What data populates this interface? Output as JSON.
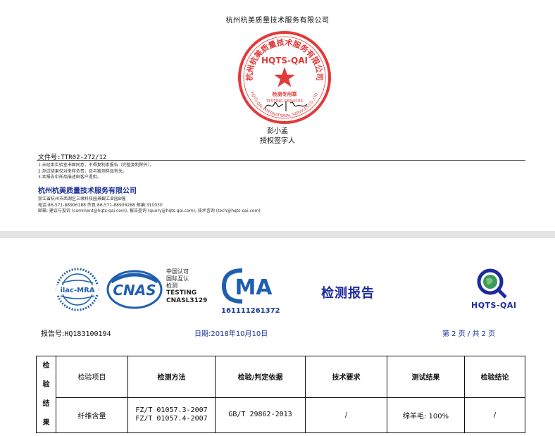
{
  "cert_page": {
    "company_header": "杭州杭美质量技术服务有限公司",
    "seal": {
      "ring_text": "杭州杭美质量技术服务有限公司",
      "center_text": "HQTS-QAI",
      "dept_text": "检测专用章",
      "testing_services": "TESTING SERVICES",
      "bottom_ring": "HQTS-QAI INTERNATIONAL SERVICES CO.,LTD."
    },
    "signer_name": "彭小孟",
    "signer_title": "授权签字人",
    "doc_number": "文件号:TTR02-272/12",
    "notes": [
      "1.未经本实验室书面同意，不得复制本报告（完整复制除外）。",
      "2.测试结果仅对来样负责，且与被测样品有关。",
      "3.本报告中样品描述由客户提供。"
    ],
    "company_name": "杭州杭美质量技术服务有限公司",
    "address_lines": [
      "浙江省杭州市西湖区三墩科技园景観工业园B幢",
      "电话:86-571-88906188   传真:86-571-88906288   邮编:310030",
      "邮箱: 建议与投诉 (comment@hqts-qai.com), 报告查询 (query@hqts-qai.com), 技术咨询 (tech@hqts-qai.com)"
    ]
  },
  "report_page": {
    "logos": {
      "ilac": "ilac-MRA",
      "cnas": "CNAS",
      "cnas_text": [
        "中国认可",
        "国际互认",
        "检测",
        "TESTING",
        "CNASL3129"
      ],
      "ma": "MA",
      "ma_number": "161111261372",
      "hqts": "HQTS-QAI"
    },
    "title": "检测报告",
    "report_no_label": "报告号:",
    "report_no": "HQ183100194",
    "date": "日期:2018年10月10日",
    "page": "第 2 页 / 共 2 页",
    "table": {
      "side_label": [
        "检",
        "验",
        "结",
        "果"
      ],
      "headers": [
        "检验项目",
        "检测方法",
        "检验/判定依据",
        "技术要求",
        "测试结果",
        "检验结论"
      ],
      "row": {
        "item": "纤维含量",
        "method_1": "FZ/T 01057.3-2007",
        "method_2": "FZ/T 01057.4-2007",
        "basis": "GB/T 29862-2013",
        "requirement": "/",
        "result": "绵羊毛: 100%",
        "conclusion": "/"
      }
    }
  },
  "colors": {
    "seal_red": "#e23a3a",
    "brand_blue": "#1c2a9c",
    "ma_blue": "#1f5fb0"
  }
}
